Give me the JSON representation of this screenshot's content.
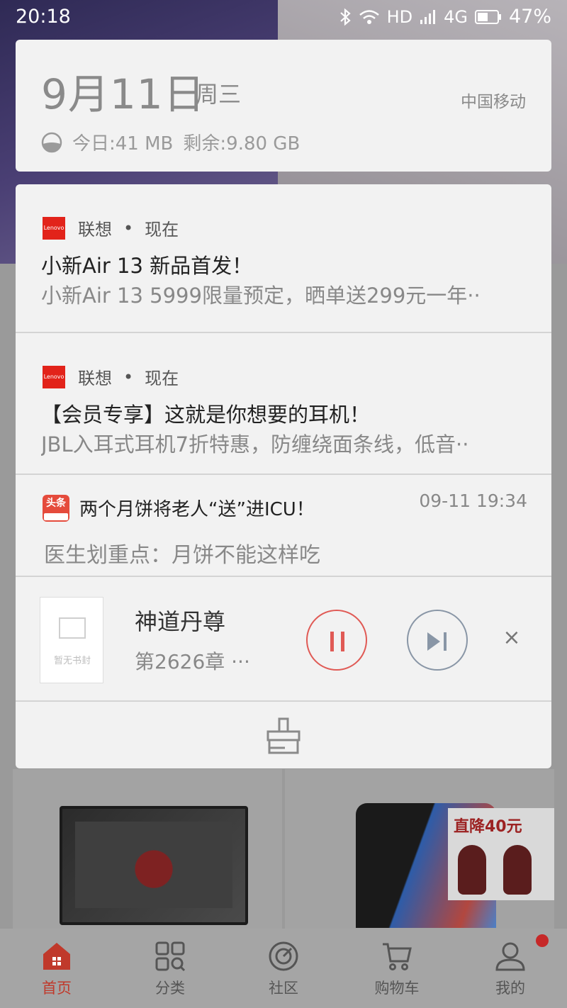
{
  "status_bar": {
    "time": "20:18",
    "network_label": "HD",
    "network_type": "4G",
    "battery": "47%"
  },
  "date_card": {
    "date": "9月11日",
    "weekday": "周三",
    "carrier": "中国移动",
    "data_today": "今日:41 MB",
    "data_remaining": "剩余:9.80 GB"
  },
  "notifications": [
    {
      "app": "联想",
      "time": "现在",
      "logo": "Lenovo",
      "title": "小新Air 13 新品首发！",
      "body": "小新Air 13 5999限量预定，晒单送299元一年··"
    },
    {
      "app": "联想",
      "time": "现在",
      "logo": "Lenovo",
      "title": "【会员专享】这就是你想要的耳机！",
      "body": "JBL入耳式耳机7折特惠，防缠绕面条线，低音··"
    },
    {
      "app_logo_text": "头条",
      "title": "两个月饼将老人“送”进ICU！",
      "time": "09-11 19:34",
      "body": "医生划重点：月饼不能这样吃"
    }
  ],
  "player": {
    "cover_text": "暂无书封",
    "title": "神道丹尊",
    "subtitle": "第2626章 ···"
  },
  "background": {
    "promo_text": "直降40元",
    "tabs": [
      {
        "label": "首页",
        "icon": "home-icon"
      },
      {
        "label": "分类",
        "icon": "category-icon"
      },
      {
        "label": "社区",
        "icon": "community-icon"
      },
      {
        "label": "购物车",
        "icon": "cart-icon"
      },
      {
        "label": "我的",
        "icon": "profile-icon"
      }
    ]
  },
  "colors": {
    "accent_red": "#e05a55",
    "lenovo_red": "#e2231a",
    "card_bg": "#f2f2f2"
  }
}
